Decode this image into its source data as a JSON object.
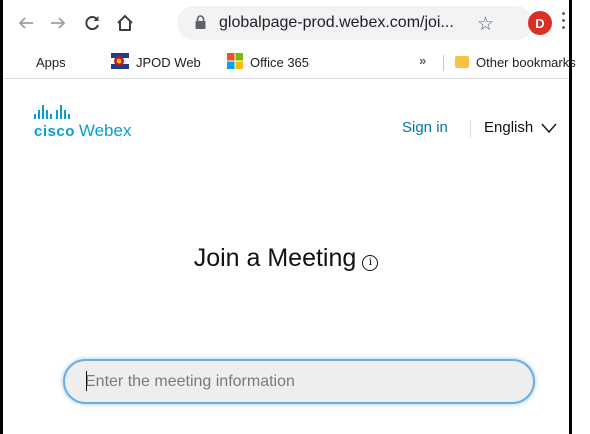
{
  "browser": {
    "url": "globalpage-prod.webex.com/joi...",
    "profile_initial": "D",
    "icons": [
      "back-icon",
      "forward-icon",
      "reload-icon",
      "home-icon",
      "lock-icon",
      "star-icon",
      "kebab-menu-icon"
    ]
  },
  "bookmarks": {
    "items": [
      {
        "label": "Apps",
        "icon": "apps-grid-icon"
      },
      {
        "label": "JPOD Web",
        "icon": "jpod-logo-icon"
      },
      {
        "label": "Office 365",
        "icon": "office-logo-icon"
      }
    ],
    "overflow": "»",
    "other": "Other bookmarks"
  },
  "page": {
    "brand_cisco": "cisco",
    "brand_webex": "Webex",
    "sign_in": "Sign in",
    "language": "English",
    "title": "Join a Meeting",
    "info_symbol": "i",
    "meeting_input_placeholder": "Enter the meeting information",
    "meeting_input_value": ""
  },
  "colors": {
    "brand_blue": "#049fd9",
    "link": "#007aa3",
    "avatar": "#d93025",
    "input_focus": "#6aaee8"
  }
}
